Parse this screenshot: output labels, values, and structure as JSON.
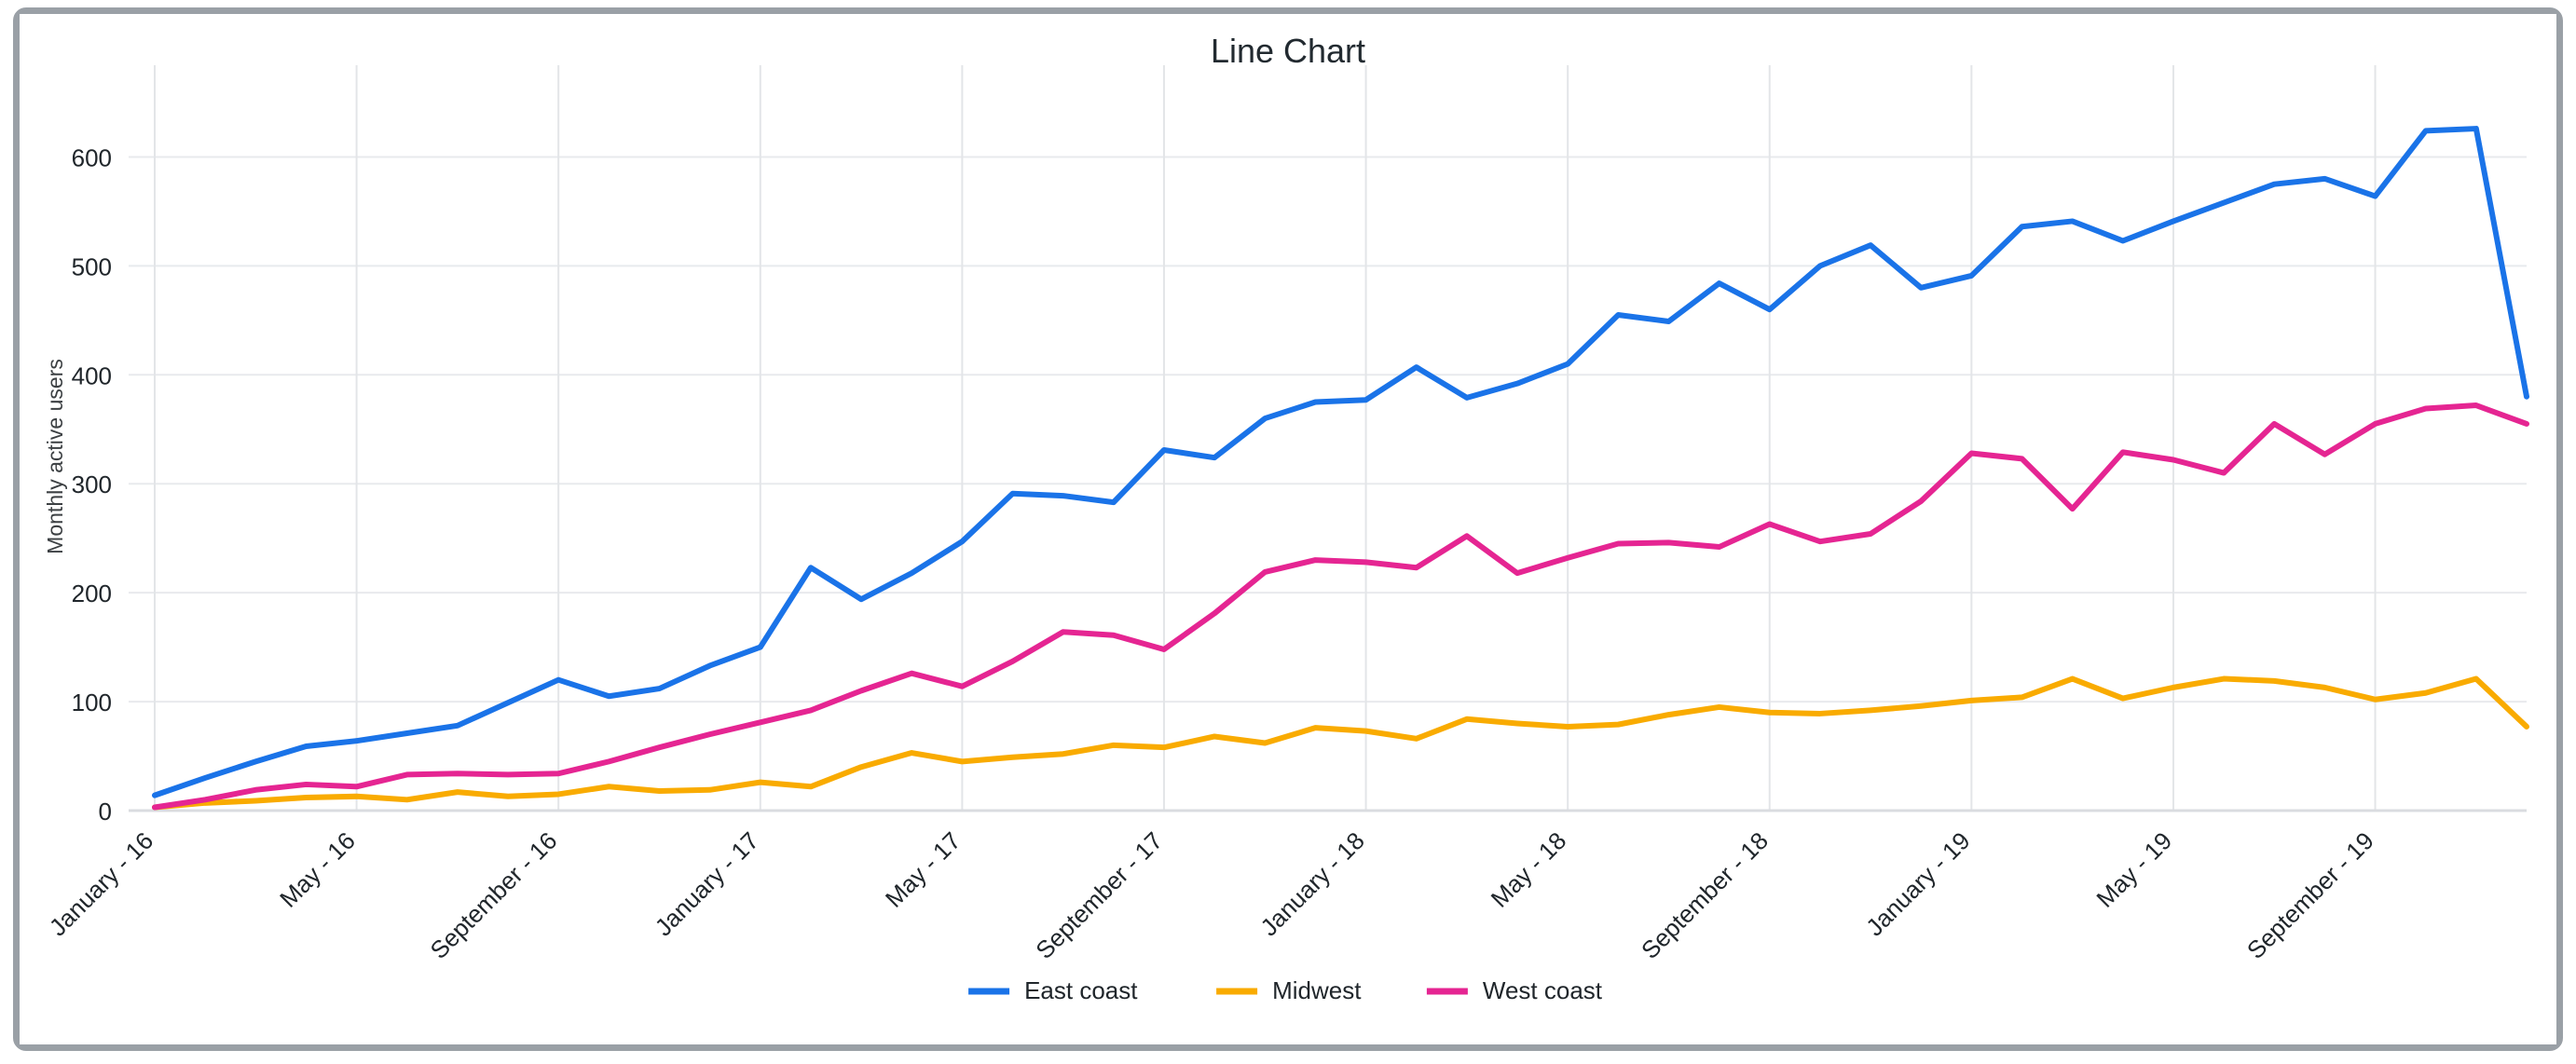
{
  "window": {
    "border_color": "#9aa0a6",
    "background": "#ffffff"
  },
  "chart_data": {
    "type": "line",
    "title": "Line Chart",
    "xlabel": "",
    "ylabel": "Monthly active users",
    "ylim": [
      0,
      650
    ],
    "yticks": [
      0,
      100,
      200,
      300,
      400,
      500,
      600
    ],
    "ytick_labels": [
      "0",
      "100",
      "200",
      "300",
      "400",
      "500",
      "600"
    ],
    "grid": true,
    "legend_position": "bottom",
    "x": [
      "January - 16",
      "February - 16",
      "March - 16",
      "April - 16",
      "May - 16",
      "June - 16",
      "July - 16",
      "August - 16",
      "September - 16",
      "October - 16",
      "November - 16",
      "December - 16",
      "January - 17",
      "February - 17",
      "March - 17",
      "April - 17",
      "May - 17",
      "June - 17",
      "July - 17",
      "August - 17",
      "September - 17",
      "October - 17",
      "November - 17",
      "December - 17",
      "January - 18",
      "February - 18",
      "March - 18",
      "April - 18",
      "May - 18",
      "June - 18",
      "July - 18",
      "August - 18",
      "September - 18",
      "October - 18",
      "November - 18",
      "December - 18",
      "January - 19",
      "February - 19",
      "March - 19",
      "April - 19",
      "May - 19",
      "June - 19",
      "July - 19",
      "August - 19",
      "September - 19",
      "October - 19",
      "November - 19",
      "December - 19"
    ],
    "xtick_labels": [
      "January - 16",
      "May - 16",
      "September - 16",
      "January - 17",
      "May - 17",
      "September - 17",
      "January - 18",
      "May - 18",
      "September - 18",
      "January - 19",
      "May - 19",
      "September - 19"
    ],
    "xtick_indices": [
      0,
      4,
      8,
      12,
      16,
      20,
      24,
      28,
      32,
      36,
      40,
      44
    ],
    "xtick_rotation": -45,
    "series": [
      {
        "name": "East coast",
        "color": "#1a73e8",
        "values": [
          14,
          30,
          45,
          59,
          64,
          71,
          78,
          99,
          120,
          105,
          112,
          133,
          150,
          223,
          194,
          218,
          247,
          291,
          289,
          283,
          331,
          324,
          360,
          375,
          377,
          407,
          379,
          392,
          410,
          455,
          449,
          484,
          460,
          500,
          519,
          480,
          491,
          536,
          541,
          523,
          541,
          558,
          575,
          580,
          564,
          624,
          626,
          380
        ]
      },
      {
        "name": "Midwest",
        "color": "#f9ab00",
        "values": [
          3,
          7,
          9,
          12,
          13,
          10,
          17,
          13,
          15,
          22,
          18,
          19,
          26,
          22,
          40,
          53,
          45,
          49,
          52,
          60,
          58,
          68,
          62,
          76,
          73,
          66,
          84,
          80,
          77,
          79,
          88,
          95,
          90,
          89,
          92,
          96,
          101,
          104,
          121,
          103,
          113,
          121,
          119,
          113,
          102,
          108,
          121,
          77
        ]
      },
      {
        "name": "West coast",
        "color": "#e52592",
        "values": [
          3,
          10,
          19,
          24,
          22,
          33,
          34,
          33,
          34,
          45,
          58,
          70,
          81,
          92,
          110,
          126,
          114,
          137,
          164,
          161,
          148,
          181,
          219,
          230,
          228,
          223,
          252,
          218,
          232,
          245,
          246,
          242,
          263,
          247,
          254,
          284,
          328,
          323,
          277,
          329,
          322,
          310,
          355,
          327,
          355,
          369,
          372,
          355
        ]
      }
    ]
  },
  "legend": {
    "items": [
      {
        "label": "East coast",
        "color": "#1a73e8"
      },
      {
        "label": "Midwest",
        "color": "#f9ab00"
      },
      {
        "label": "West coast",
        "color": "#e52592"
      }
    ]
  }
}
